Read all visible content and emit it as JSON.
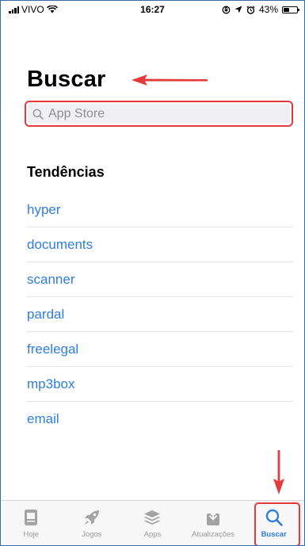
{
  "status_bar": {
    "carrier": "VIVO",
    "time": "16:27",
    "battery_text": "43%",
    "battery_level": 0.43
  },
  "page": {
    "title": "Buscar"
  },
  "search": {
    "placeholder": "App Store"
  },
  "trends": {
    "heading": "Tendências",
    "items": [
      "hyper",
      "documents",
      "scanner",
      "pardal",
      "freelegal",
      "mp3box",
      "email"
    ]
  },
  "tab_bar": {
    "tabs": [
      {
        "label": "Hoje",
        "icon": "today-icon",
        "active": false
      },
      {
        "label": "Jogos",
        "icon": "rocket-icon",
        "active": false
      },
      {
        "label": "Apps",
        "icon": "apps-stack-icon",
        "active": false
      },
      {
        "label": "Atualizações",
        "icon": "updates-download-icon",
        "active": false
      },
      {
        "label": "Buscar",
        "icon": "search-icon",
        "active": true
      }
    ]
  },
  "colors": {
    "accent": "#2f7de0",
    "annotation": "#e33b3b",
    "inactive": "#9b9b9b"
  }
}
